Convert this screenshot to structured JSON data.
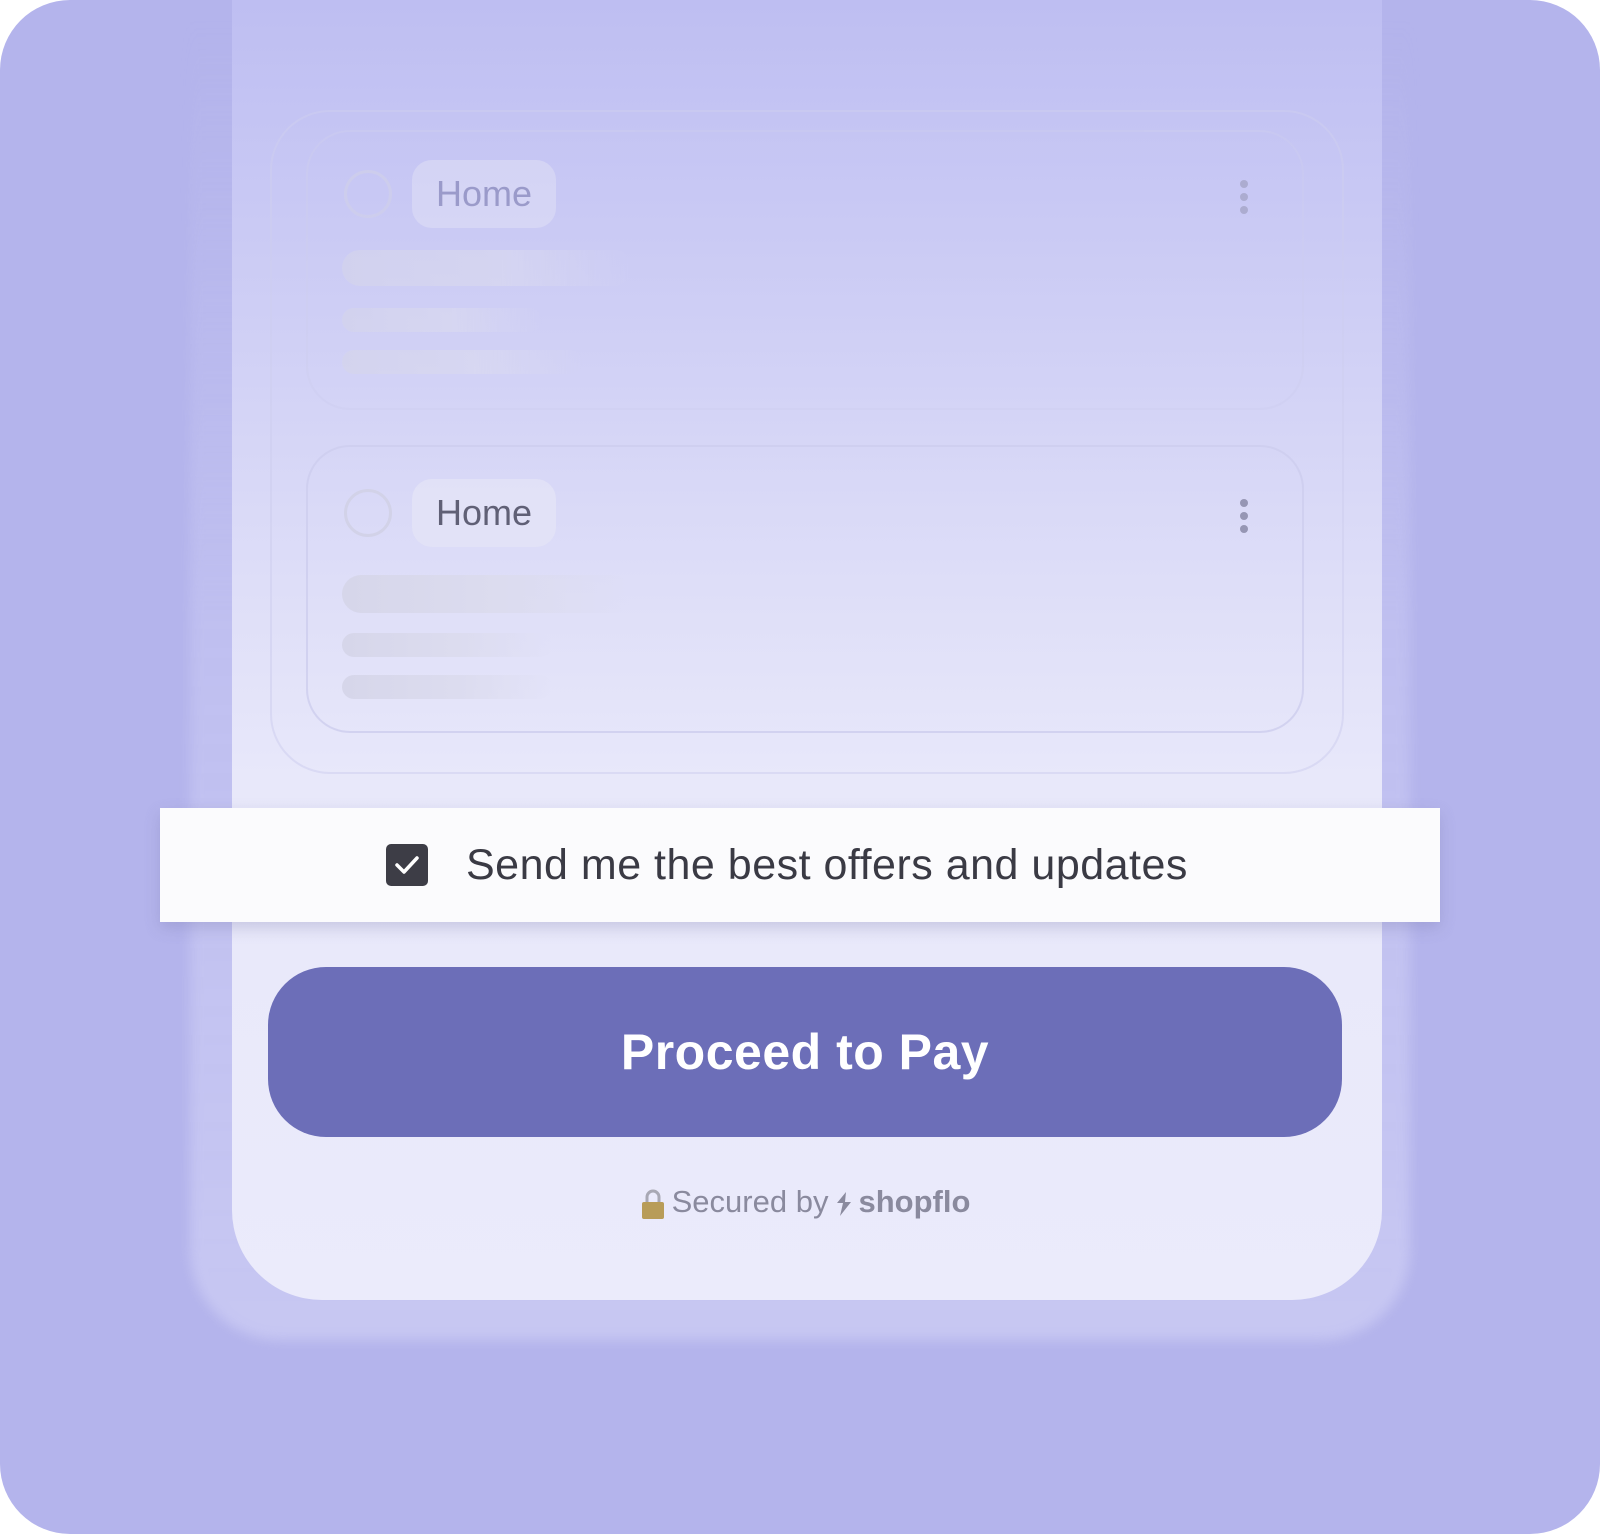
{
  "colors": {
    "background": "#b4b4ec",
    "button": "#6c6eb8",
    "checkbox": "#3d3d46"
  },
  "address_cards": [
    {
      "label": "Home",
      "selected": false
    },
    {
      "label": "Home",
      "selected": false
    }
  ],
  "optin": {
    "checked": true,
    "label": "Send me the best offers and updates"
  },
  "pay_button": {
    "label": "Proceed to Pay"
  },
  "footer": {
    "secured_text": "Secured by",
    "brand": "shopflo",
    "icons": [
      "lock-icon",
      "shopflo-logo-icon"
    ]
  }
}
